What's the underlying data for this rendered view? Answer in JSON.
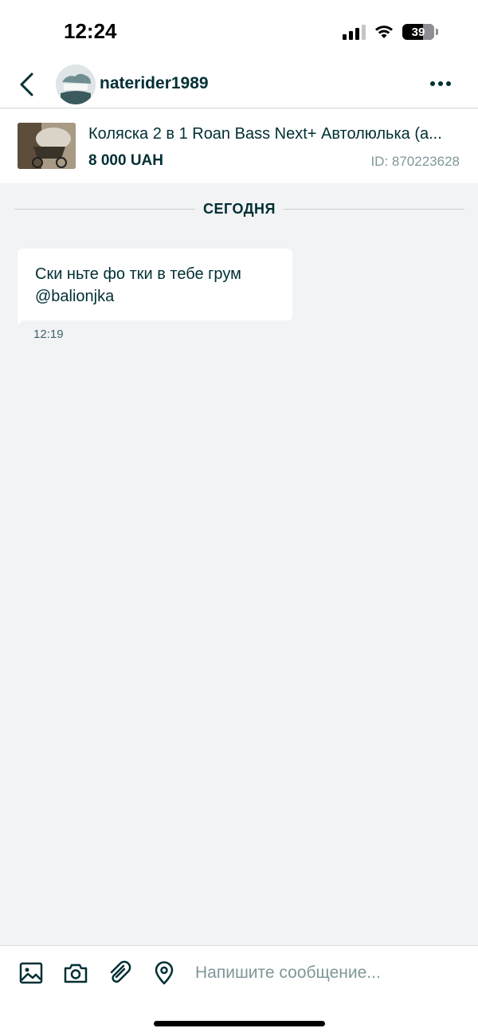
{
  "status_bar": {
    "time": "12:24",
    "battery": "39"
  },
  "header": {
    "username": "naterider1989"
  },
  "product": {
    "title": "Коляска 2 в 1 Roan Bass Next+ Автолюлька (а...",
    "price": "8 000 UAH",
    "id": "ID: 870223628"
  },
  "chat": {
    "date_divider": "СЕГОДНЯ",
    "messages": [
      {
        "text": "Ски ньте фо тки в тебе грум @balionjka",
        "time": "12:19"
      }
    ]
  },
  "composer": {
    "placeholder": "Напишите сообщение..."
  },
  "colors": {
    "brand_dark": "#002f34",
    "background": "#f2f3f5",
    "muted": "#7f9799"
  },
  "icons": [
    "back-icon",
    "more-icon",
    "image-icon",
    "camera-icon",
    "paperclip-icon",
    "location-icon",
    "wifi-icon",
    "signal-icon",
    "battery-icon"
  ]
}
